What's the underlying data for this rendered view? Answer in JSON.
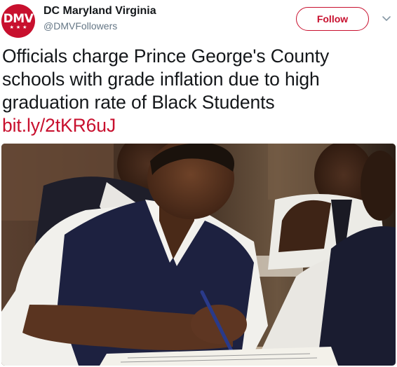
{
  "tweet": {
    "avatar": {
      "logo_text": "DMV",
      "stars": "★★★",
      "brand_color": "#c8102e"
    },
    "author": {
      "display_name": "DC Maryland Virginia",
      "handle": "@DMVFollowers"
    },
    "follow_label": "Follow",
    "menu_icon": "chevron-down-icon",
    "text_lines": [
      "Officials charge Prince George's County",
      "schools with grade inflation due to high",
      "graduation rate of Black Students"
    ],
    "link_text": "bit.ly/2tKR6uJ",
    "media": {
      "kind": "photo"
    }
  }
}
